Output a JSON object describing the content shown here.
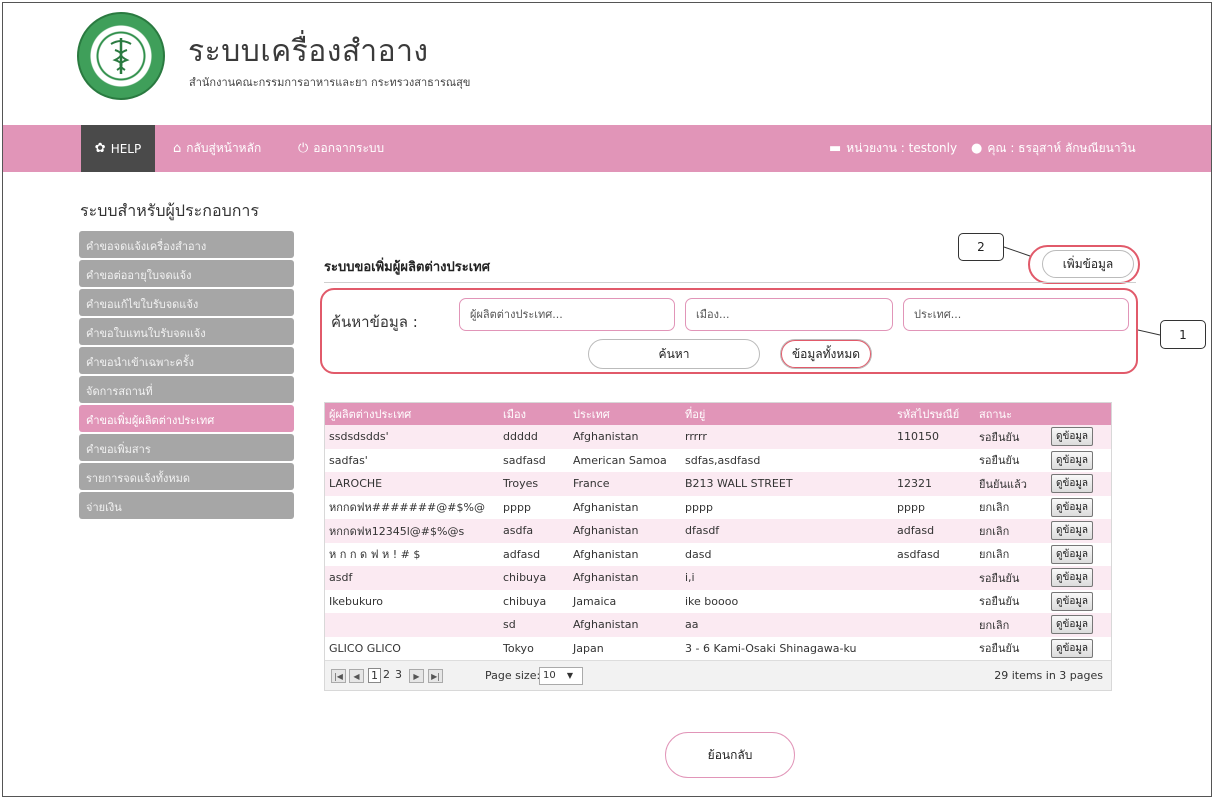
{
  "header": {
    "app_title": "ระบบเครื่องสำอาง",
    "app_subtitle": "สำนักงานคณะกรรมการอาหารและยา กระทรวงสาธารณสุข"
  },
  "navbar": {
    "help": "HELP",
    "home": "กลับสู่หน้าหลัก",
    "logout": "ออกจากระบบ",
    "unit": "หน่วยงาน : testonly",
    "user": "คุณ : ธรอุสาห์ ลักษณียนาวิน"
  },
  "sidebar": {
    "title": "ระบบสำหรับผู้ประกอบการ",
    "items": [
      {
        "label": "คำขอจดแจ้งเครื่องสำอาง"
      },
      {
        "label": "คำขอต่ออายุใบจดแจ้ง"
      },
      {
        "label": "คำขอแก้ไขใบรับจดแจ้ง"
      },
      {
        "label": "คำขอใบแทนใบรับจดแจ้ง"
      },
      {
        "label": "คำขอนำเข้าเฉพาะครั้ง"
      },
      {
        "label": "จัดการสถานที่"
      },
      {
        "label": "คำขอเพิ่มผู้ผลิตต่างประเทศ"
      },
      {
        "label": "คำขอเพิ่มสาร"
      },
      {
        "label": "รายการจดแจ้งทั้งหมด"
      },
      {
        "label": "จ่ายเงิน"
      }
    ],
    "active_index": 6
  },
  "main": {
    "section_title": "ระบบขอเพิ่มผู้ผลิตต่างประเทศ",
    "add_button": "เพิ่มข้อมูล",
    "callout_1": "1",
    "callout_2": "2",
    "search": {
      "label": "ค้นหาข้อมูล :",
      "manufacturer_placeholder": "ผู้ผลิตต่างประเทศ...",
      "city_placeholder": "เมือง...",
      "country_placeholder": "ประเทศ...",
      "search_button": "ค้นหา",
      "all_button": "ข้อมูลทั้งหมด"
    },
    "table": {
      "columns": [
        "ผู้ผลิตต่างประเทศ",
        "เมือง",
        "ประเทศ",
        "ที่อยู่",
        "รหัสไปรษณีย์",
        "สถานะ",
        ""
      ],
      "view_label": "ดูข้อมูล",
      "rows": [
        {
          "manufacturer": "ssdsdsdds'",
          "city": "ddddd",
          "country": "Afghanistan",
          "address": "rrrrr",
          "postcode": "110150",
          "status": "รอยืนยัน"
        },
        {
          "manufacturer": "sadfas'",
          "city": "sadfasd",
          "country": "American Samoa",
          "address": "sdfas,asdfasd",
          "postcode": "",
          "status": "รอยืนยัน"
        },
        {
          "manufacturer": "LAROCHE",
          "city": "Troyes",
          "country": "France",
          "address": "B213 WALL STREET",
          "postcode": "12321",
          "status": "ยืนยันแล้ว"
        },
        {
          "manufacturer": "หกกดฟห#######@#$%@",
          "city": "pppp",
          "country": "Afghanistan",
          "address": "pppp",
          "postcode": "pppp",
          "status": "ยกเลิก"
        },
        {
          "manufacturer": "หกกดฟห12345l@#$%@s",
          "city": "asdfa",
          "country": "Afghanistan",
          "address": "dfasdf",
          "postcode": "adfasd",
          "status": "ยกเลิก"
        },
        {
          "manufacturer": "ห ก ก ด ฟ ห ! # $",
          "city": "adfasd",
          "country": "Afghanistan",
          "address": "dasd",
          "postcode": "asdfasd",
          "status": "ยกเลิก"
        },
        {
          "manufacturer": "asdf",
          "city": "chibuya",
          "country": "Afghanistan",
          "address": "i,i",
          "postcode": "",
          "status": "รอยืนยัน"
        },
        {
          "manufacturer": "Ikebukuro",
          "city": "chibuya",
          "country": "Jamaica",
          "address": "ike boooo",
          "postcode": "",
          "status": "รอยืนยัน"
        },
        {
          "manufacturer": "",
          "city": "sd",
          "country": "Afghanistan",
          "address": "aa",
          "postcode": "",
          "status": "ยกเลิก"
        },
        {
          "manufacturer": "GLICO GLICO",
          "city": "Tokyo",
          "country": "Japan",
          "address": "3 - 6 Kami-Osaki Shinagawa-ku",
          "postcode": "",
          "status": "รอยืนยัน"
        }
      ]
    },
    "pager": {
      "pages": [
        "1",
        "2",
        "3"
      ],
      "current_page": "1",
      "page_size_label": "Page size:",
      "page_size": "10",
      "info": "29 items in 3 pages"
    },
    "back_button": "ย้อนกลับ"
  },
  "colors": {
    "accent_pink": "#e195b8",
    "row_pink": "#fbeaf2",
    "help_dark": "#4a4a4a",
    "sidebar_gray": "#a6a6a6",
    "highlight_red": "#e15a6a"
  },
  "icons": {
    "help": "gear-icon",
    "home": "home-icon",
    "logout": "power-icon",
    "unit": "briefcase-icon",
    "user": "user-icon"
  }
}
